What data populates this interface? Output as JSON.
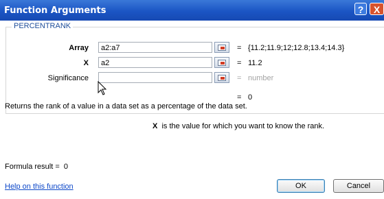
{
  "window": {
    "title": "Function Arguments",
    "help_symbol": "?",
    "close_symbol": "X"
  },
  "function_name": "PERCENTRANK",
  "args": [
    {
      "label": "Array",
      "value": "a2:a7",
      "result": "{11.2;11.9;12;12.8;13.4;14.3}"
    },
    {
      "label": "X",
      "value": "a2",
      "result": "11.2"
    },
    {
      "label": "Significance",
      "value": "",
      "result": "number"
    }
  ],
  "equals_sign": "=",
  "overall_result": "0",
  "description": "Returns the rank of a value in a data set as a percentage of the data set.",
  "arg_help": {
    "name": "X",
    "text": "is the value for which you want to know the rank."
  },
  "formula_result": {
    "label": "Formula result =",
    "value": "0"
  },
  "help_link": "Help on this function",
  "buttons": {
    "ok": "OK",
    "cancel": "Cancel"
  }
}
